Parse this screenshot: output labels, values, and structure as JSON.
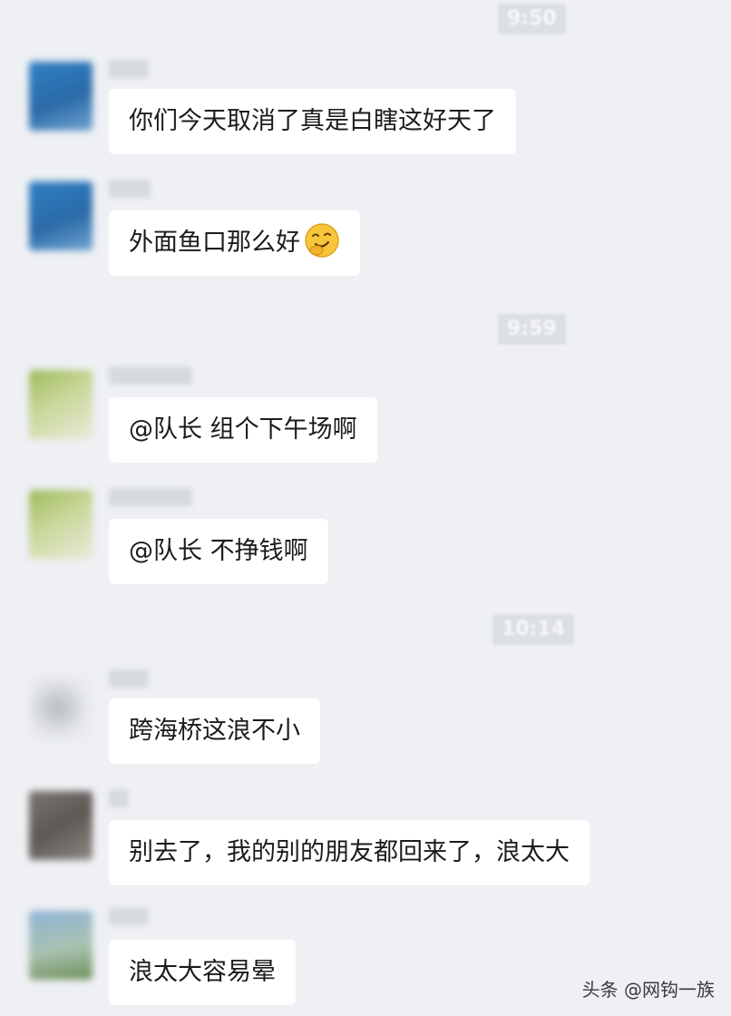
{
  "timestamps": [
    "9:50",
    "9:59",
    "10:14"
  ],
  "messages": [
    {
      "text": "你们今天取消了真是白瞎这好天了"
    },
    {
      "text": "外面鱼口那么好",
      "emoji": "grinning-hand-on-chin-emoji"
    },
    {
      "text": "@队长 组个下午场啊"
    },
    {
      "text": "@队长 不挣钱啊"
    },
    {
      "text": "跨海桥这浪不小"
    },
    {
      "text": "别去了，我的别的朋友都回来了，浪太大"
    },
    {
      "text": "浪太大容易晕"
    }
  ],
  "watermark": "头条 @网钩一族",
  "colors": {
    "background": "#eef0f4",
    "bubble": "#ffffff",
    "timestamp_bg": "#dcdfe4"
  }
}
